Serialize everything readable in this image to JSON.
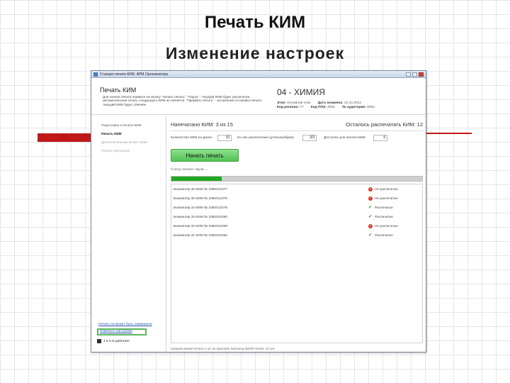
{
  "slide": {
    "title": "Печать КИМ",
    "subtitle": "Изменение настроек"
  },
  "window": {
    "title": "Станция печати КИМ. АРМ Организатора"
  },
  "header": {
    "title": "Печать КИМ",
    "instructions": "Для начала печати нажмите на кнопку \"Начать печать\". \"Пауза\" - текущий КИМ будет распечатан, автоматическая печать следующего КИМ не начнётся. \"Прервать печать\" - экстренная остановка печати, текущий КИМ будет отменён",
    "subject": "04 - ХИМИЯ",
    "meta": [
      {
        "label": "Этап:",
        "value": "Основной этап"
      },
      {
        "label": "Дата экзамена:",
        "value": "22.10.2014"
      },
      {
        "label": "Код региона:",
        "value": "77"
      },
      {
        "label": "Код ППЭ:",
        "value": "3001"
      },
      {
        "label": "№ аудитории:",
        "value": "0002"
      }
    ]
  },
  "sidebar": {
    "items": [
      {
        "label": "Подготовка к печати КИМ",
        "state": "normal"
      },
      {
        "label": "Печать КИМ",
        "state": "active"
      },
      {
        "label": "Дополнительная печать КИМ",
        "state": "disabled"
      },
      {
        "label": "Печать протокола",
        "state": "disabled"
      }
    ],
    "warning": "Печать не может быть завершена",
    "settings_link": "Изменить настройки",
    "user": "1 К 5 И работает"
  },
  "main": {
    "printed_label": "Напечатано КИМ:  3  из  15",
    "remaining_label": "Осталось распечатать КИМ:  12",
    "fields": {
      "disk_label": "Количество КИМ на диске:",
      "disk_value": "15",
      "printed_label": "Из них распечатано (успешно/брак):",
      "printed_value": "3/3",
      "available_label": "Доступно для печати КИМ:",
      "available_value": "9"
    },
    "start_button": "Начать печать",
    "status": "Статус печати:  пауза ...",
    "progress": 0.2,
    "documents": [
      {
        "name": "Экземпляр 36  КИМ № 3360012077",
        "status": "Не распечатан",
        "ok": false
      },
      {
        "name": "Экземпляр 35  КИМ № 3360012076",
        "status": "Не распечатан",
        "ok": false
      },
      {
        "name": "Экземпляр 34  КИМ № 3360012075",
        "status": "Распечатан",
        "ok": true
      },
      {
        "name": "Экземпляр 33  КИМ № 3360012060",
        "status": "Распечатан",
        "ok": true
      },
      {
        "name": "Экземпляр 32  КИМ № 3360012059",
        "status": "Не распечатан",
        "ok": false
      },
      {
        "name": "Экземпляр 31  КИМ № 3360012062",
        "status": "Распечатан",
        "ok": true
      }
    ],
    "footer_note": "Среднее время печати 1 шт не принтере Samsung M2020 Series: 10 сек"
  },
  "colors": {
    "accent_red": "#c01818",
    "progress_green": "#20a820",
    "button_green": "#52c452"
  }
}
